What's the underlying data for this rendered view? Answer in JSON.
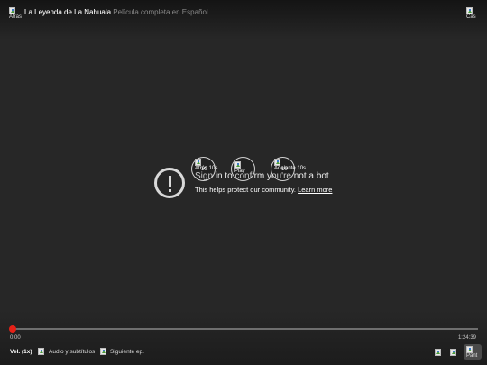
{
  "header": {
    "back_icon_alt": "Atrás",
    "title": "La Leyenda de La Nahuala",
    "title_faded": "La Leyenda de La Nahuala Película completa en Español",
    "cast_icon_alt": "Cas"
  },
  "error": {
    "title": "Sign in to confirm you're not a bot",
    "subtitle": "This helps protect our community.",
    "learn_more": "Learn more"
  },
  "center_controls": {
    "rewind_alt": "Atrás 10s",
    "rewind_badge": "10",
    "play_alt": "Play",
    "forward_alt": "Adelante 10s",
    "forward_badge": "10"
  },
  "progress": {
    "current_time": "0:00",
    "total_time": "1:24:39",
    "fraction": 0.0
  },
  "bottom_bar": {
    "speed_label": "Vel. (1x)",
    "audio_subtitles_label": "Audio y subtítulos",
    "next_episode_label": "Siguiente ep.",
    "pip_alt": "Pant"
  },
  "colors": {
    "background": "#272727",
    "accent_red": "#e62117"
  }
}
